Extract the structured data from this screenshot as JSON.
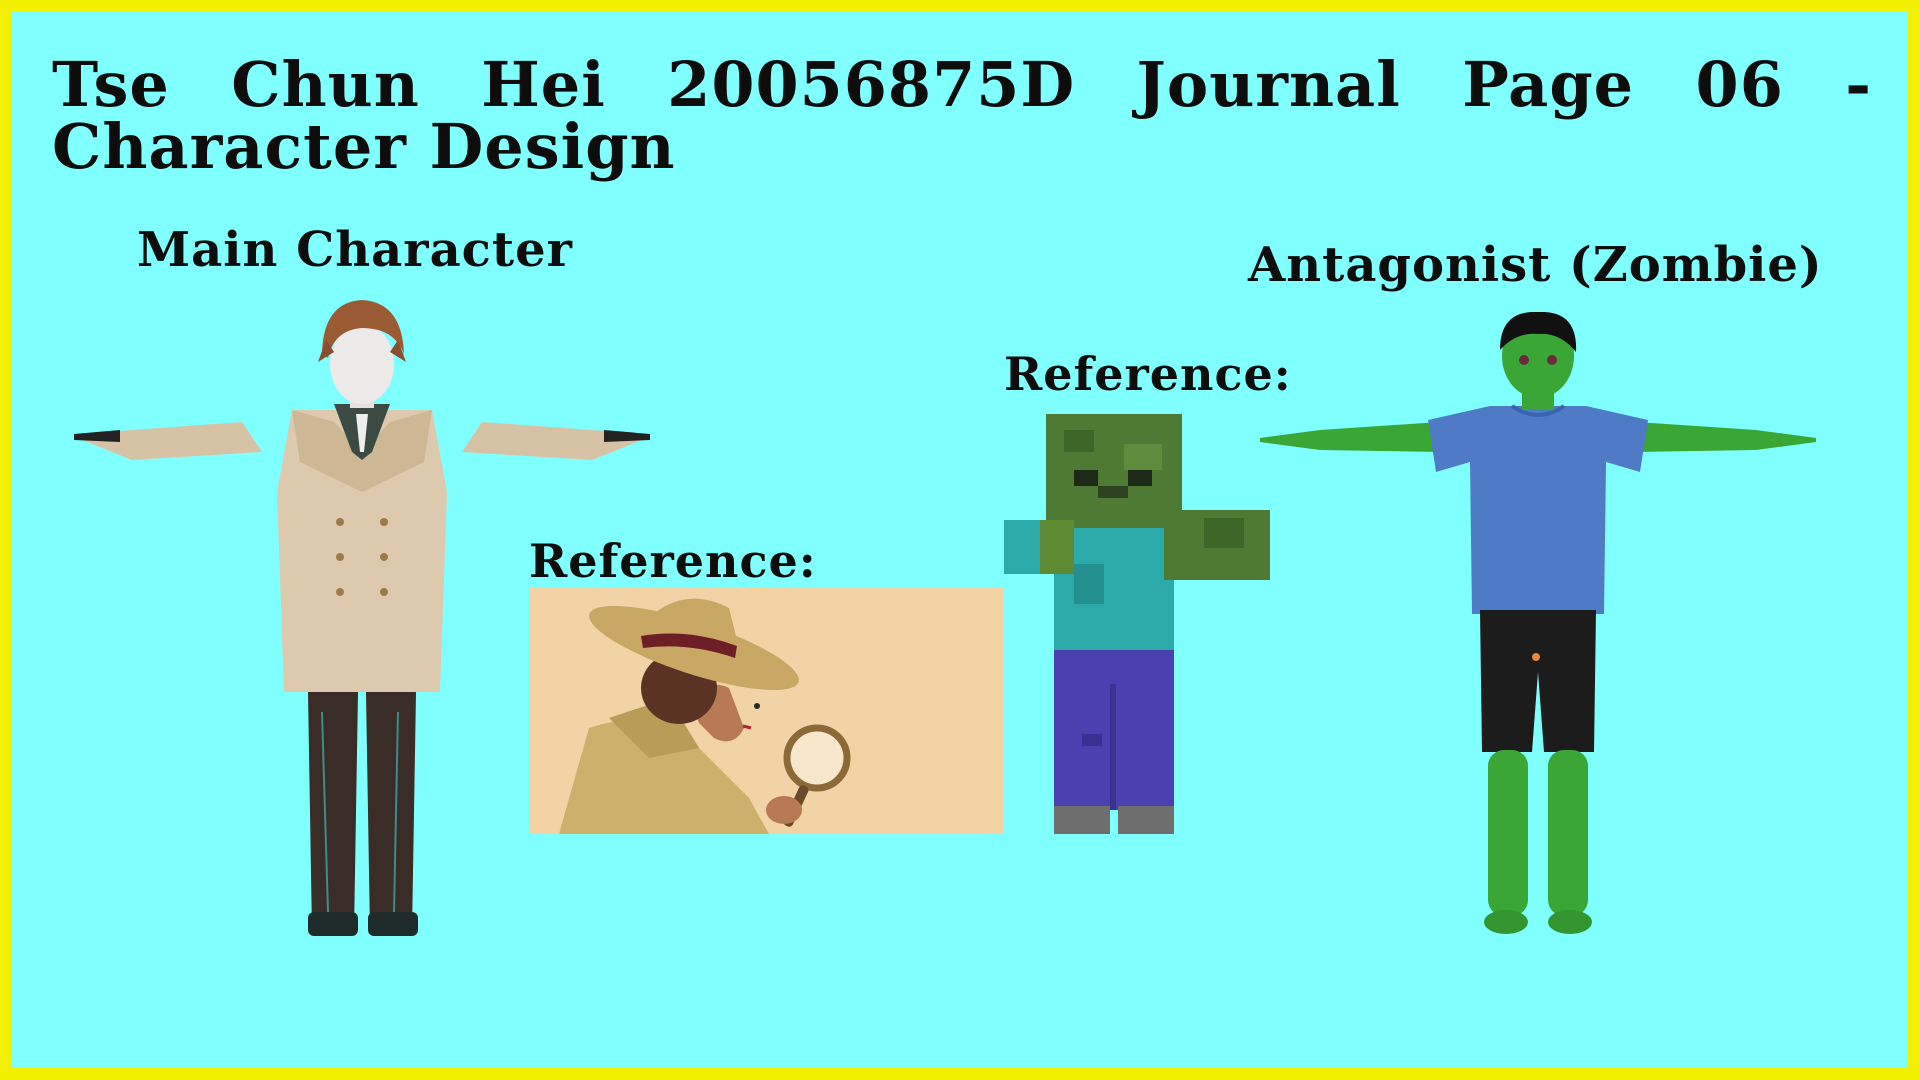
{
  "page": {
    "title": "Tse Chun Hei 20056875D Journal Page 06 - Character Design",
    "main_label": "Main Character",
    "antagonist_label": "Antagonist (Zombie)",
    "reference_label_1": "Reference:",
    "reference_label_2": "Reference:"
  },
  "colors": {
    "background": "#80ffff",
    "border": "#f0f000",
    "coat": "#dcc9ae",
    "zombie_skin": "#3aa635",
    "zombie_shirt": "#4f7bc6",
    "minecraft_shirt": "#2ca9a9",
    "minecraft_pants": "#4a40b0"
  },
  "icons": [
    "detective-character-model",
    "detective-reference-illustration",
    "minecraft-zombie-reference",
    "zombie-character-model"
  ]
}
